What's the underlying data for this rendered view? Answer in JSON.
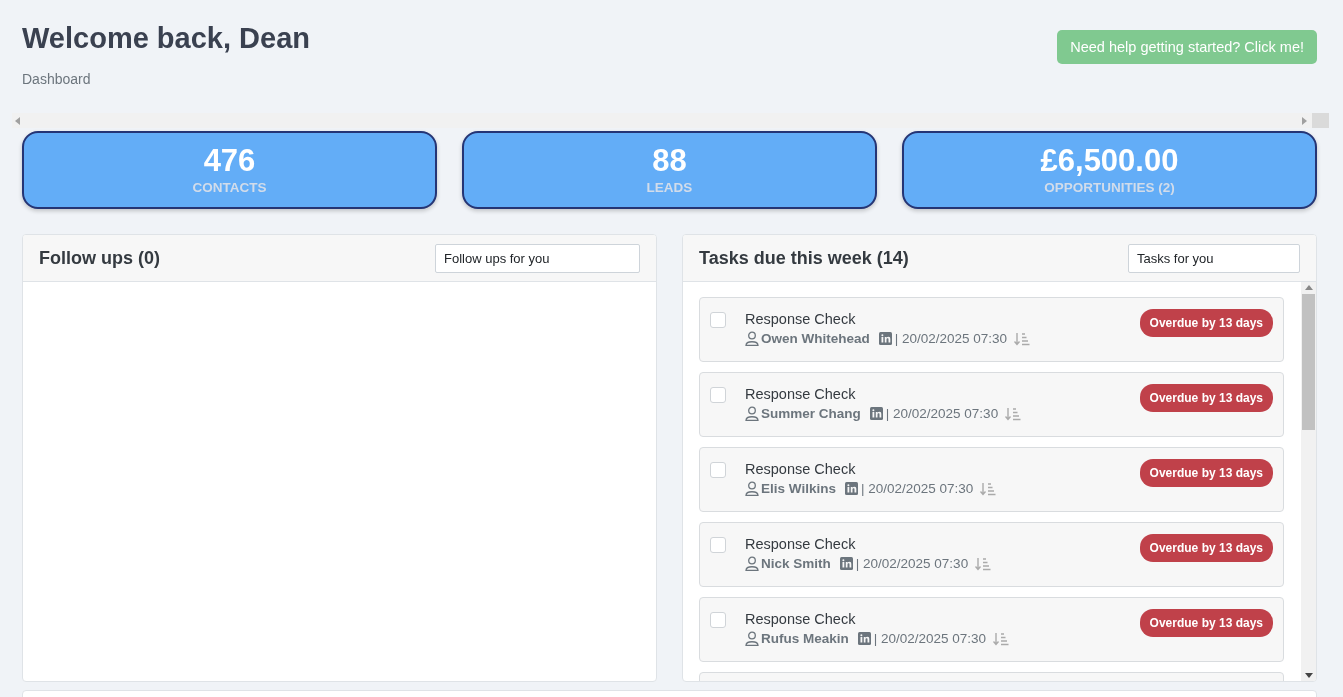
{
  "header": {
    "title": "Welcome back, Dean",
    "breadcrumb": "Dashboard",
    "help_button": "Need help getting started? Click me!"
  },
  "stats": [
    {
      "value": "476",
      "label": "CONTACTS"
    },
    {
      "value": "88",
      "label": "LEADS"
    },
    {
      "value": "£6,500.00",
      "label": "OPPORTUNITIES (2)"
    }
  ],
  "follow_ups": {
    "title": "Follow ups (0)",
    "filter": "Follow ups for you"
  },
  "tasks": {
    "title": "Tasks due this week (14)",
    "filter": "Tasks for you",
    "items": [
      {
        "name": "Response Check",
        "contact": "Owen Whitehead",
        "date": "| 20/02/2025 07:30",
        "badge": "Overdue by 13 days",
        "checked": false
      },
      {
        "name": "Response Check",
        "contact": "Summer Chang",
        "date": "| 20/02/2025 07:30",
        "badge": "Overdue by 13 days",
        "checked": false
      },
      {
        "name": "Response Check",
        "contact": "Elis Wilkins",
        "date": "| 20/02/2025 07:30",
        "badge": "Overdue by 13 days",
        "checked": false
      },
      {
        "name": "Response Check",
        "contact": "Nick Smith",
        "date": "| 20/02/2025 07:30",
        "badge": "Overdue by 13 days",
        "checked": false
      },
      {
        "name": "Response Check",
        "contact": "Rufus Meakin",
        "date": "| 20/02/2025 07:30",
        "badge": "Overdue by 13 days",
        "checked": false
      }
    ]
  }
}
